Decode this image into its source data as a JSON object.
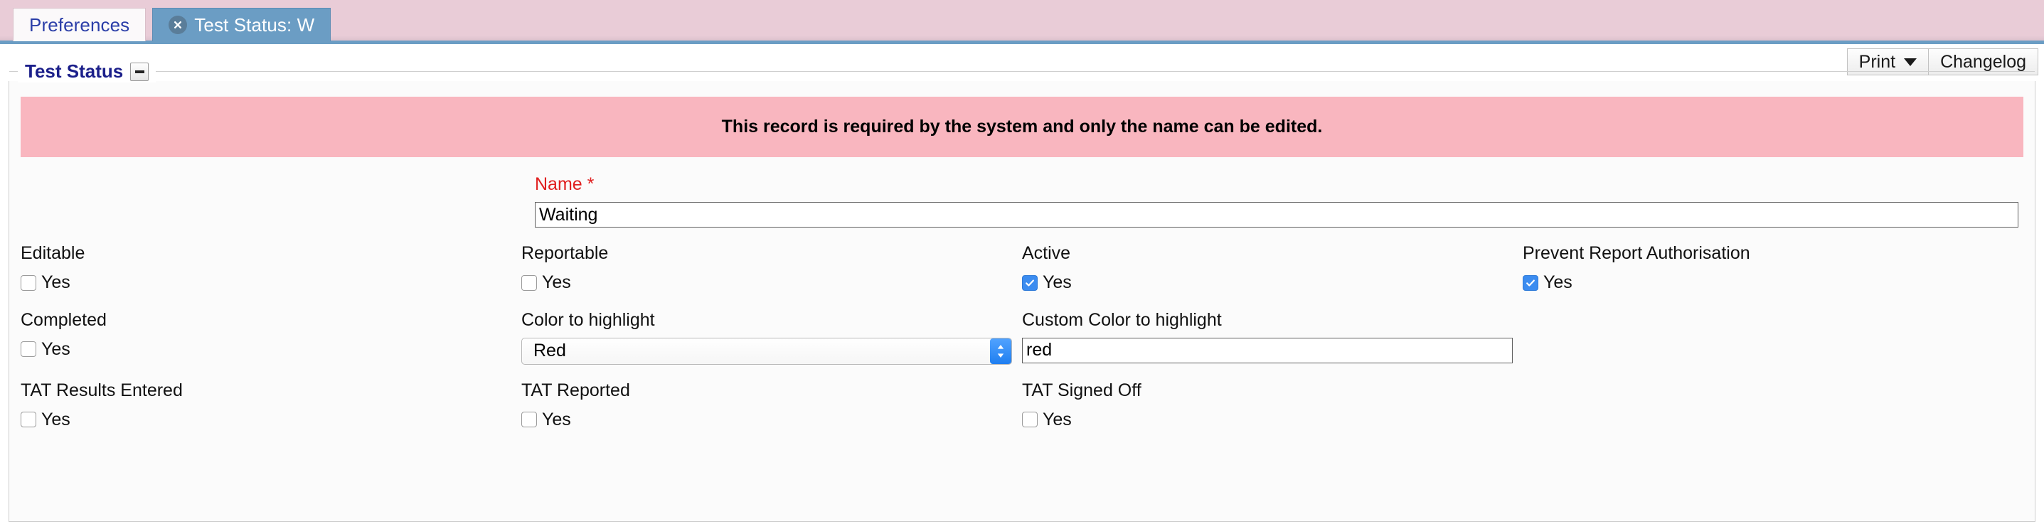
{
  "tabs": [
    {
      "label": "Preferences",
      "active": false,
      "closable": false
    },
    {
      "label": "Test Status: W",
      "active": true,
      "closable": true,
      "close_icon": "close-circle-icon"
    }
  ],
  "toolbar": {
    "print_label": "Print",
    "print_caret_icon": "caret-down-icon",
    "changelog_label": "Changelog"
  },
  "panel": {
    "legend_title": "Test Status",
    "collapse_icon": "minus-icon"
  },
  "alert": {
    "message": "This record is required by the system and only the name can be edited.",
    "background": "#f9b6bf",
    "text_color": "#000000"
  },
  "form": {
    "name": {
      "label": "Name *",
      "label_color": "#e02020",
      "value": "Waiting",
      "placeholder": ""
    },
    "row1": [
      {
        "label": "Editable",
        "option": "Yes",
        "checked": false
      },
      {
        "label": "Reportable",
        "option": "Yes",
        "checked": false
      },
      {
        "label": "Active",
        "option": "Yes",
        "checked": true
      },
      {
        "label": "Prevent Report Authorisation",
        "option": "Yes",
        "checked": true
      }
    ],
    "row2": {
      "completed": {
        "label": "Completed",
        "option": "Yes",
        "checked": false
      },
      "color_to_highlight": {
        "label": "Color to highlight",
        "selected": "Red",
        "options": [
          "Red"
        ],
        "stepper_icon": "chevron-up-down-icon"
      },
      "custom_color": {
        "label": "Custom Color to highlight",
        "value": "red",
        "placeholder": ""
      }
    },
    "row3": [
      {
        "label": "TAT Results Entered",
        "option": "Yes",
        "checked": false
      },
      {
        "label": "TAT Reported",
        "option": "Yes",
        "checked": false
      },
      {
        "label": "TAT Signed Off",
        "option": "Yes",
        "checked": false
      }
    ]
  },
  "colors": {
    "tab_strip_bg": "#e9ccd7",
    "active_tab_bg": "#6b9dc4",
    "tab_link_text": "#2b3ea8",
    "legend_text": "#1b1f8a",
    "checkbox_checked": "#3b8cf0"
  }
}
